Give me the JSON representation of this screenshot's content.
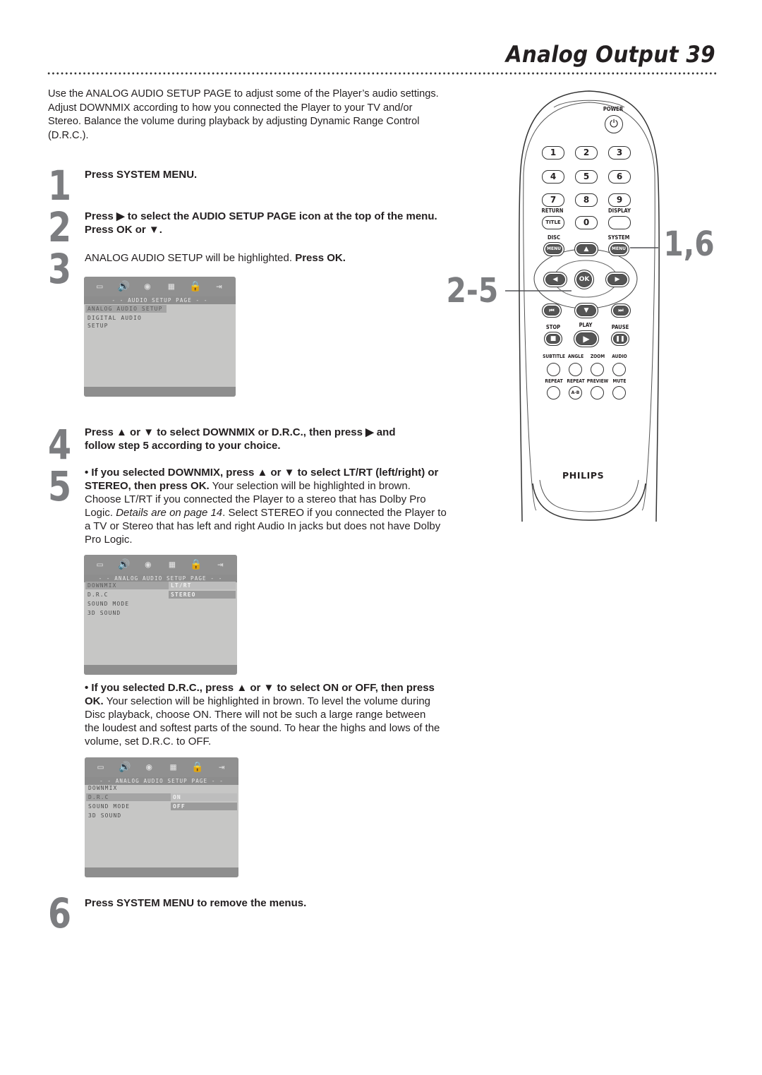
{
  "header": {
    "title": "Analog Output 39"
  },
  "intro": {
    "line1": "Use the ANALOG AUDIO SETUP PAGE to adjust some of the Player’s audio settings.",
    "line2": "Adjust DOWNMIX according to how you connected the Player to your TV and/or Stereo. Balance the volume during playback by adjusting Dynamic Range Control (D.R.C.)."
  },
  "steps": [
    {
      "number": "1",
      "parts": [
        {
          "t": "Press SYSTEM MENU.",
          "b": true
        }
      ]
    },
    {
      "number": "2",
      "parts": [
        {
          "t": "Press ▶ to select the AUDIO SETUP PAGE icon at the top of the menu.  Press OK or ▼.",
          "b": true
        }
      ]
    },
    {
      "number": "3",
      "parts": [
        {
          "t": "ANALOG AUDIO SETUP will be highlighted. ",
          "b": false
        },
        {
          "t": "Press OK.",
          "b": true
        }
      ]
    },
    {
      "number": "4",
      "parts": [
        {
          "t": "Press ▲ or ▼ to select DOWNMIX or D.R.C., then press ▶ and follow step 5 according to your choice.",
          "b": true
        }
      ]
    },
    {
      "number": "5",
      "parts": [
        {
          "t": "• If you selected DOWNMIX, press ▲ or ▼ to select LT/RT (left/right) or STEREO, then press OK.",
          "b": true
        },
        {
          "t": " Your selection will be highlighted in brown. Choose LT/RT if you connected the Player to a stereo that has Dolby Pro Logic. ",
          "b": false
        },
        {
          "t": "Details are on page 14",
          "i": true
        },
        {
          "t": ". Select STEREO if you connected the Player to a TV or Stereo that has left and right Audio In jacks but does not have Dolby Pro Logic.",
          "b": false
        }
      ]
    },
    {
      "number": "",
      "parts": [
        {
          "t": "• If you selected D.R.C., press ▲ or ▼ to select ON or OFF, then press OK.",
          "b": true
        },
        {
          "t": " Your selection will be highlighted in brown. To level the volume during Disc playback, choose ON. There will not be such a large range between the loudest and softest parts of the sound. To hear the highs and lows of the volume, set D.R.C. to OFF.",
          "b": false
        }
      ]
    },
    {
      "number": "6",
      "parts": [
        {
          "t": "Press SYSTEM MENU to remove the menus.",
          "b": true
        }
      ]
    }
  ],
  "osd_screens": [
    {
      "header": "- -  AUDIO  SETUP  PAGE  - -",
      "items": [
        {
          "label": "ANALOG  AUDIO  SETUP",
          "highlighted": true
        },
        {
          "label": "DIGITAL  AUDIO  SETUP",
          "highlighted": false
        }
      ],
      "options": []
    },
    {
      "header": "- -  ANALOG  AUDIO  SETUP  PAGE  - -",
      "items": [
        {
          "label": "DOWNMIX",
          "highlighted": true
        },
        {
          "label": "D.R.C",
          "highlighted": false
        },
        {
          "label": "SOUND  MODE",
          "highlighted": false
        },
        {
          "label": "3D  SOUND",
          "highlighted": false
        }
      ],
      "options": [
        {
          "label": "LT/RT",
          "selected": false
        },
        {
          "label": "STEREO",
          "selected": true
        }
      ]
    },
    {
      "header": "- -  ANALOG  AUDIO  SETUP  PAGE  - -",
      "items": [
        {
          "label": "DOWNMIX",
          "highlighted": false
        },
        {
          "label": "D.R.C",
          "highlighted": true
        },
        {
          "label": "SOUND  MODE",
          "highlighted": false
        },
        {
          "label": "3D  SOUND",
          "highlighted": false
        }
      ],
      "options": [
        {
          "label": "ON",
          "selected": false
        },
        {
          "label": "OFF",
          "selected": true
        }
      ]
    }
  ],
  "osd_icons": [
    "tv-icon",
    "audio-speaker-icon",
    "disc-icon",
    "preference-icon",
    "lock-icon",
    "exit-icon"
  ],
  "remote": {
    "brand": "PHILIPS",
    "power_label": "POWER",
    "number_keys": [
      "1",
      "2",
      "3",
      "4",
      "5",
      "6",
      "7",
      "8",
      "9"
    ],
    "return_label": "RETURN",
    "display_label": "DISPLAY",
    "title_key": "TITLE",
    "zero_key": "0",
    "disc_label": "DISC",
    "system_label": "SYSTEM",
    "menu_key": "MENU",
    "ok_key": "OK",
    "stop_label": "STOP",
    "play_label": "PLAY",
    "pause_label": "PAUSE",
    "row1_labels": [
      "SUBTITLE",
      "ANGLE",
      "ZOOM",
      "AUDIO"
    ],
    "row2_labels": [
      "REPEAT",
      "REPEAT",
      "PREVIEW",
      "MUTE"
    ],
    "ab_key": "A-B"
  },
  "callouts": {
    "system_menu": "1,6",
    "navigation": "2-5"
  }
}
